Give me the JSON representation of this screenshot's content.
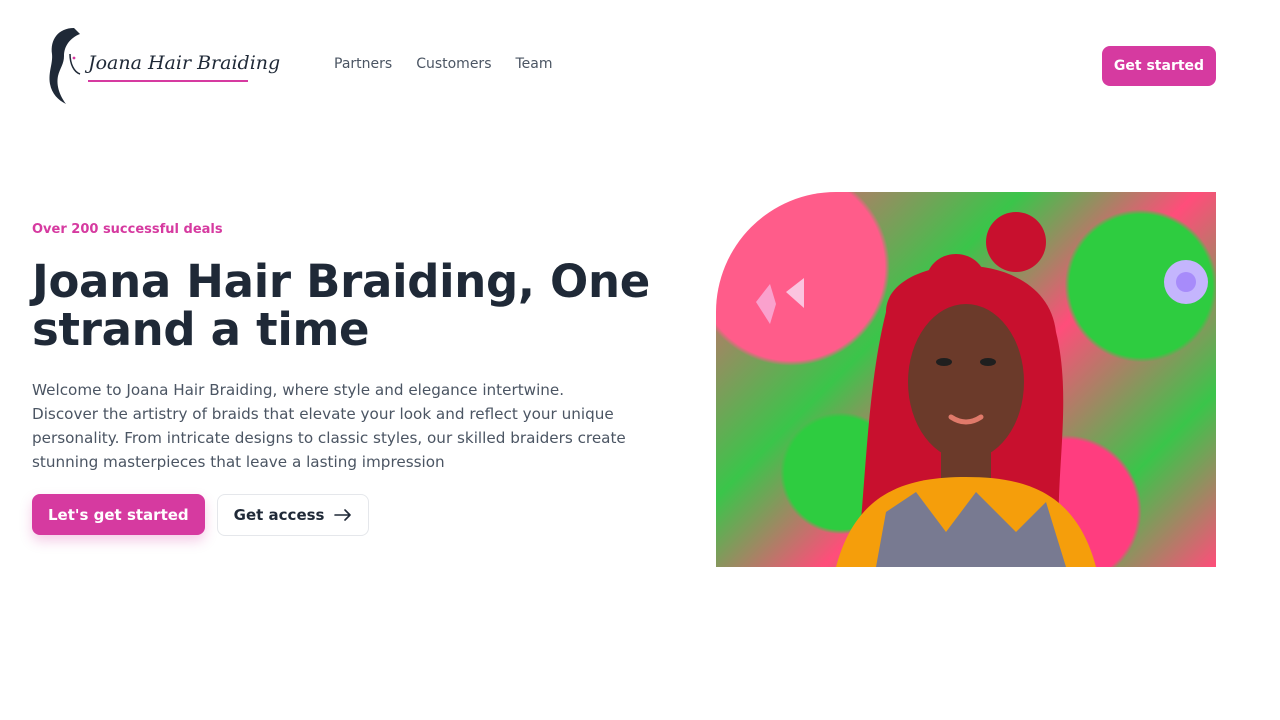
{
  "brand": {
    "name": "Joana Hair Braiding",
    "accent_color": "#d63aa0"
  },
  "nav": {
    "items": [
      {
        "label": "Partners"
      },
      {
        "label": "Customers"
      },
      {
        "label": "Team"
      }
    ]
  },
  "header": {
    "cta_label": "Get started"
  },
  "hero": {
    "eyebrow": "Over 200 successful deals",
    "title": "Joana Hair Braiding, One strand a time",
    "description": "Welcome to Joana Hair Braiding, where style and elegance intertwine. Discover the artistry of braids that elevate your look and reflect your unique personality. From intricate designs to classic styles, our skilled braiders create stunning masterpieces that leave a lasting impression",
    "primary_cta": "Let's get started",
    "secondary_cta": "Get access",
    "secondary_cta_icon": "arrow-right-icon"
  }
}
